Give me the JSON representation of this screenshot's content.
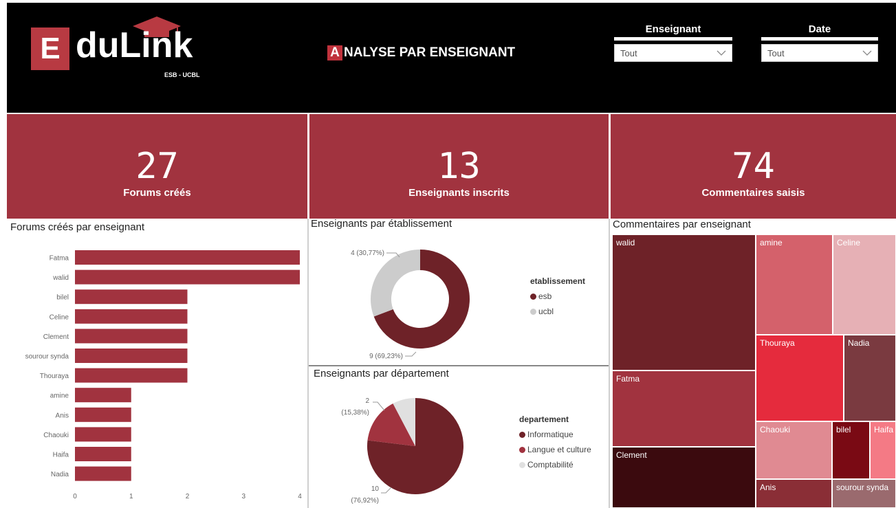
{
  "header": {
    "logo_letter": "E",
    "logo_rest": "duLink",
    "logo_sub": "ESB - UCBL",
    "title_first": "A",
    "title_rest": "NALYSE PAR ENSEIGNANT",
    "slicers": [
      {
        "label": "Enseignant",
        "value": "Tout"
      },
      {
        "label": "Date",
        "value": "Tout"
      }
    ]
  },
  "colors": {
    "kpi": "#a1333f",
    "esb": "#6e2228",
    "ucbl": "#cccccc",
    "informatique": "#6e2228",
    "langue": "#a1333f",
    "comptabilite": "#e0e0e0"
  },
  "kpis": [
    {
      "value": "27",
      "label": "Forums créés"
    },
    {
      "value": "13",
      "label": "Enseignants inscrits"
    },
    {
      "value": "74",
      "label": "Commentaires saisis"
    }
  ],
  "panels": {
    "forums": "Forums créés par enseignant",
    "etab": "Enseignants par établissement",
    "dept": "Enseignants par département",
    "comments": "Commentaires par enseignant"
  },
  "legends": {
    "etab_title": "etablissement",
    "etab_items": [
      "esb",
      "ucbl"
    ],
    "dept_title": "departement",
    "dept_items": [
      "Informatique",
      "Langue et culture",
      "Comptabilité"
    ]
  },
  "chart_data": [
    {
      "type": "bar",
      "orientation": "horizontal",
      "title": "Forums créés par enseignant",
      "categories": [
        "Fatma",
        "walid",
        "bilel",
        "Celine",
        "Clement",
        "sourour synda",
        "Thouraya",
        "amine",
        "Anis",
        "Chaouki",
        "Haifa",
        "Nadia"
      ],
      "values": [
        4,
        4,
        2,
        2,
        2,
        2,
        2,
        1,
        1,
        1,
        1,
        1
      ],
      "xlim": [
        0,
        4
      ],
      "xticks": [
        "0",
        "1",
        "2",
        "3",
        "4"
      ]
    },
    {
      "type": "pie",
      "donut": true,
      "title": "Enseignants par établissement",
      "legend_title": "etablissement",
      "slices": [
        {
          "label": "esb",
          "value": 9,
          "text": "9 (69,23%)"
        },
        {
          "label": "ucbl",
          "value": 4,
          "text": "4 (30,77%)"
        }
      ]
    },
    {
      "type": "pie",
      "title": "Enseignants par département",
      "legend_title": "departement",
      "slices": [
        {
          "label": "Informatique",
          "value": 10,
          "text_a": "10",
          "text_b": "(76,92%)"
        },
        {
          "label": "Langue et culture",
          "value": 2,
          "text_a": "2",
          "text_b": "(15,38%)"
        },
        {
          "label": "Comptabilité",
          "value": 1
        }
      ]
    },
    {
      "type": "treemap",
      "title": "Commentaires par enseignant",
      "cells": [
        {
          "label": "walid",
          "color": "#6e2228"
        },
        {
          "label": "amine",
          "color": "#d4616b"
        },
        {
          "label": "Celine",
          "color": "#e6b0b5"
        },
        {
          "label": "Fatma",
          "color": "#a1333f"
        },
        {
          "label": "Thouraya",
          "color": "#e52b3d"
        },
        {
          "label": "Nadia",
          "color": "#7a3a40"
        },
        {
          "label": "Clement",
          "color": "#3b0a0e"
        },
        {
          "label": "Chaouki",
          "color": "#e08a92"
        },
        {
          "label": "bilel",
          "color": "#7a0a14"
        },
        {
          "label": "Haifa",
          "color": "#f47a85"
        },
        {
          "label": "Anis",
          "color": "#8a2e36"
        },
        {
          "label": "sourour synda",
          "color": "#9a6a6e"
        }
      ]
    }
  ]
}
